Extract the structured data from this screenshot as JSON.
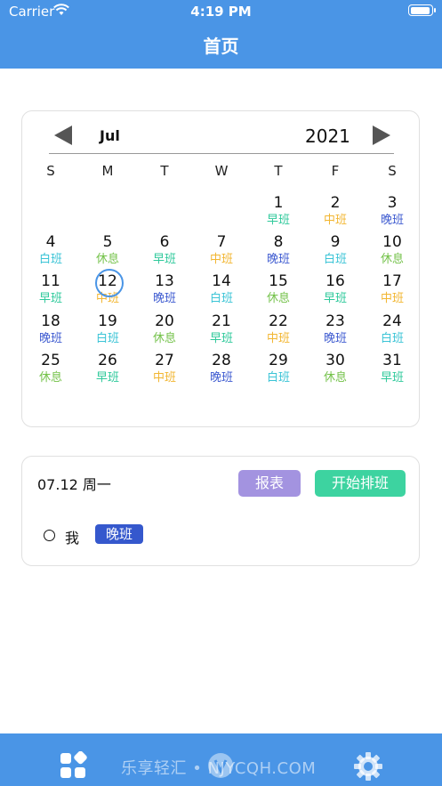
{
  "status_bar": {
    "carrier": "Carrier",
    "time": "4:19 PM"
  },
  "header": {
    "title": "首页"
  },
  "calendar": {
    "month": "Jul",
    "year": "2021",
    "weekdays": [
      "S",
      "M",
      "T",
      "W",
      "T",
      "F",
      "S"
    ],
    "selected_day": "12",
    "days": [
      {
        "day": "1",
        "shift": "早班"
      },
      {
        "day": "2",
        "shift": "中班"
      },
      {
        "day": "3",
        "shift": "晚班"
      },
      {
        "day": "4",
        "shift": "白班"
      },
      {
        "day": "5",
        "shift": "休息"
      },
      {
        "day": "6",
        "shift": "早班"
      },
      {
        "day": "7",
        "shift": "中班"
      },
      {
        "day": "8",
        "shift": "晚班"
      },
      {
        "day": "9",
        "shift": "白班"
      },
      {
        "day": "10",
        "shift": "休息"
      },
      {
        "day": "11",
        "shift": "早班"
      },
      {
        "day": "12",
        "shift": "中班"
      },
      {
        "day": "13",
        "shift": "晚班"
      },
      {
        "day": "14",
        "shift": "白班"
      },
      {
        "day": "15",
        "shift": "休息"
      },
      {
        "day": "16",
        "shift": "早班"
      },
      {
        "day": "17",
        "shift": "中班"
      },
      {
        "day": "18",
        "shift": "晚班"
      },
      {
        "day": "19",
        "shift": "白班"
      },
      {
        "day": "20",
        "shift": "休息"
      },
      {
        "day": "21",
        "shift": "早班"
      },
      {
        "day": "22",
        "shift": "中班"
      },
      {
        "day": "23",
        "shift": "晚班"
      },
      {
        "day": "24",
        "shift": "白班"
      },
      {
        "day": "25",
        "shift": "休息"
      },
      {
        "day": "26",
        "shift": "早班"
      },
      {
        "day": "27",
        "shift": "中班"
      },
      {
        "day": "28",
        "shift": "晚班"
      },
      {
        "day": "29",
        "shift": "白班"
      },
      {
        "day": "30",
        "shift": "休息"
      },
      {
        "day": "31",
        "shift": "早班"
      }
    ],
    "first_weekday_index": 4,
    "shift_colors": {
      "早班": "#2FC99B",
      "中班": "#F2B632",
      "晚班": "#3E5BD0",
      "白班": "#3BC4D6",
      "休息": "#74C24A"
    }
  },
  "detail": {
    "date_label": "07.12 周一",
    "report_button": "报表",
    "start_button": "开始排班",
    "person_name": "我",
    "person_shift": "晚班"
  },
  "tabbar": {
    "watermark": "乐享轻汇 • NJYCQH.COM",
    "icons": [
      "apps-icon",
      "logo-icon",
      "gear-icon"
    ]
  },
  "colors": {
    "primary": "#4A95E6",
    "report_button": "#A393E0",
    "start_button": "#3DD3A0",
    "shift_badge": "#3558CD"
  }
}
